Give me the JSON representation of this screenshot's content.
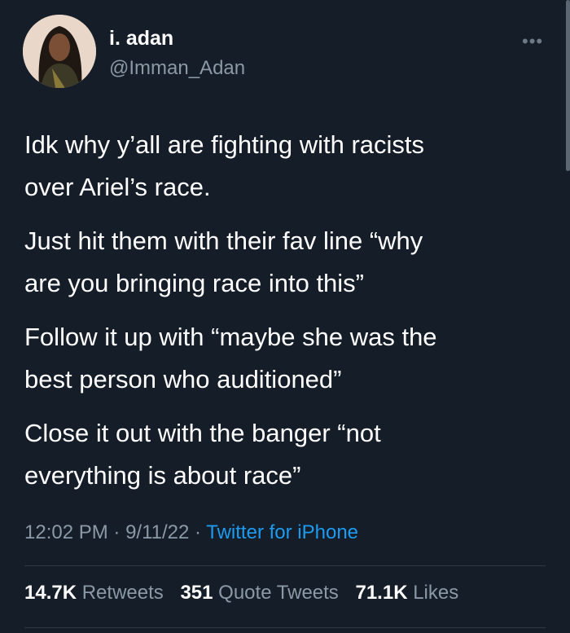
{
  "author": {
    "name": "i. adan",
    "handle": "@Imman_Adan"
  },
  "tweet": {
    "paragraphs": [
      "Idk why y’all are fighting with racists\nover Ariel’s race.",
      "Just hit them with their fav line “why\nare you bringing race into this”",
      "Follow it up with “maybe she was the\nbest person who auditioned”",
      "Close it out with the banger “not\neverything is about race”"
    ],
    "time": "12:02 PM",
    "date": "9/11/22",
    "source": "Twitter for iPhone",
    "separator": " · "
  },
  "stats": {
    "retweets_count": "14.7K",
    "retweets_label": "Retweets",
    "quotes_count": "351",
    "quotes_label": "Quote Tweets",
    "likes_count": "71.1K",
    "likes_label": "Likes"
  },
  "icons": {
    "more": "more-horizontal-icon"
  },
  "colors": {
    "background": "#151d28",
    "text_primary": "#ffffff",
    "text_secondary": "#8b98a5",
    "link": "#1d9bf0",
    "divider": "#2f3944"
  }
}
